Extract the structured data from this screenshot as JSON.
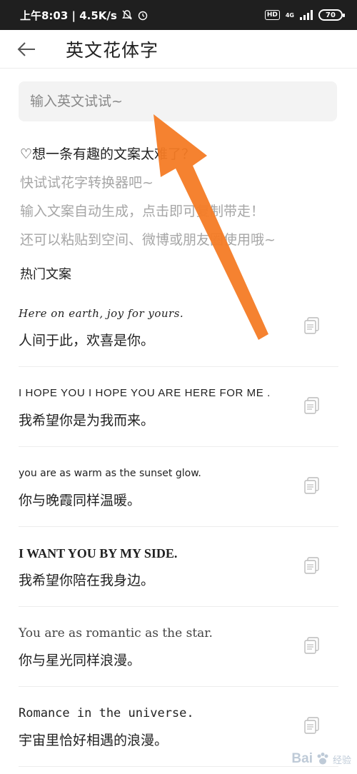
{
  "status_bar": {
    "time_speed": "上午8:03 | 4.5K/s",
    "hd": "HD",
    "network": "4G",
    "battery": "70"
  },
  "header": {
    "title": "英文花体字"
  },
  "search": {
    "placeholder": "输入英文试试~"
  },
  "intro": {
    "question": "♡想一条有趣的文案太难了？",
    "line1": "快试试花字转换器吧~",
    "line2": "输入文案自动生成，点击即可复制带走！",
    "line3": "还可以粘贴到空间、微博或朋友圈使用哦~"
  },
  "section_title": "热门文案",
  "items": [
    {
      "en": "Here on earth, joy for yours.",
      "cn": "人间于此，欢喜是你。"
    },
    {
      "en": "I HOPE YOU I HOPE YOU ARE HERE FOR ME .",
      "cn": "我希望你是为我而来。"
    },
    {
      "en": "you are as warm as the sunset glow.",
      "cn": "你与晚霞同样温暖。"
    },
    {
      "en": "I WANT YOU BY MY SIDE.",
      "cn": "我希望你陪在我身边。"
    },
    {
      "en": "You are as romantic as the star.",
      "cn": "你与星光同样浪漫。"
    },
    {
      "en": "Romance in the universe.",
      "cn": "宇宙里恰好相遇的浪漫。"
    }
  ],
  "watermark": {
    "brand": "Bai",
    "sub": "经验"
  },
  "colors": {
    "status_bar_bg": "#1f1f1f",
    "arrow": "#f47b25",
    "hint_text": "#a6a6a6"
  }
}
